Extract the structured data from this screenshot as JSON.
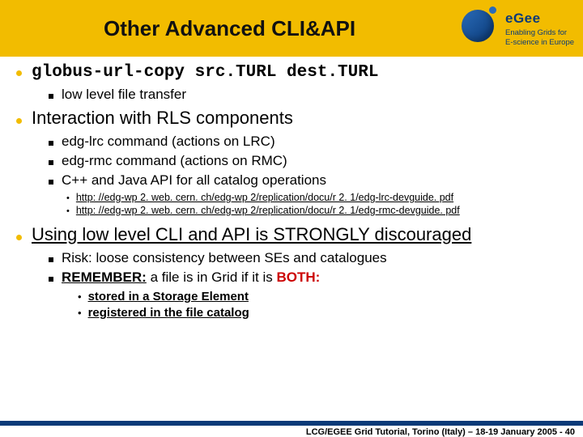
{
  "title": "Other Advanced  CLI&API",
  "logo": {
    "brand": "eGee",
    "line1": "Enabling Grids for",
    "line2": "E-science in Europe"
  },
  "bullets": [
    {
      "text": "globus-url-copy src.TURL dest.TURL",
      "sub": [
        "low level file transfer"
      ]
    },
    {
      "text": "Interaction with RLS components",
      "sub": [
        "edg-lrc command (actions on LRC)",
        "edg-rmc command (actions on RMC)",
        "C++ and Java API for all catalog operations"
      ],
      "links": [
        "http: //edg-wp 2. web. cern. ch/edg-wp 2/replication/docu/r 2. 1/edg-lrc-devguide. pdf",
        "http: //edg-wp 2. web. cern. ch/edg-wp 2/replication/docu/r 2. 1/edg-rmc-devguide. pdf"
      ]
    },
    {
      "text": "Using low level CLI and API is STRONGLY discouraged",
      "sub": [
        "Risk: loose consistency between SEs and catalogues"
      ],
      "remember": {
        "label": "REMEMBER:",
        "mid": " a file is in Grid if it is ",
        "both": "BOTH:"
      },
      "sub2": [
        "stored in a Storage Element",
        "registered in the file catalog"
      ]
    }
  ],
  "footer": "LCG/EGEE Grid Tutorial, Torino (Italy) – 18-19 January 2005 - 40"
}
